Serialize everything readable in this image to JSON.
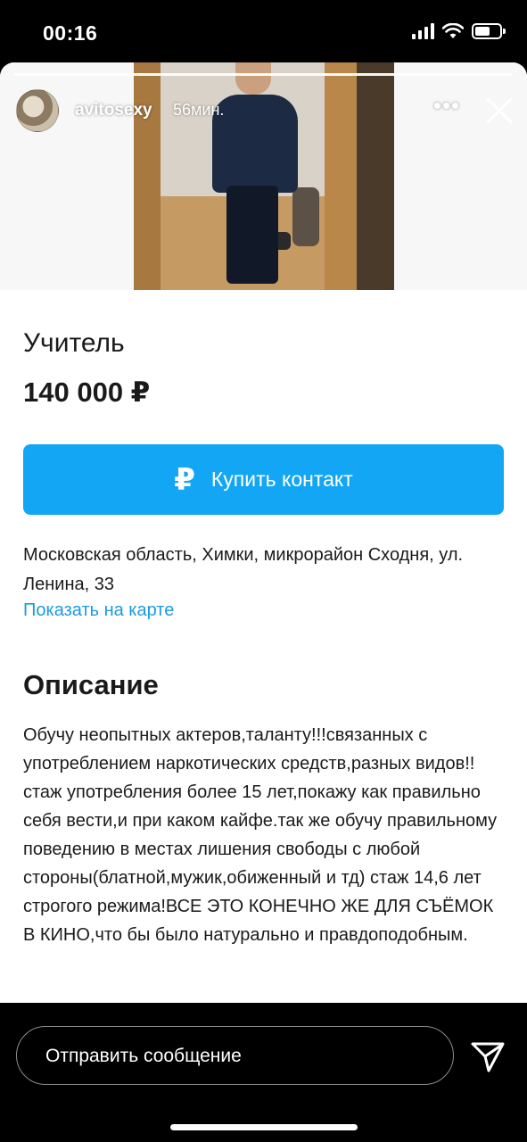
{
  "status_bar": {
    "time": "00:16",
    "icons": [
      "cellular-signal-icon",
      "wifi-icon",
      "battery-icon"
    ],
    "battery_level": 0.6
  },
  "story": {
    "username": "avitosexy",
    "time_ago": "56мин.",
    "more_icon": "more-horizontal-icon",
    "more_glyph": "•••",
    "close_icon": "close-icon"
  },
  "listing": {
    "title": "Учитель",
    "price": "140 000 ₽",
    "buy_icon": "ruble-icon",
    "buy_glyph": "₽",
    "buy_button": "Купить контакт",
    "address": "Московская область, Химки, микрорайон Сходня, ул. Ленина, 33",
    "map_link": "Показать на карте",
    "description_title": "Описание",
    "description": "Обучу неопытных актеров,таланту!!!связанных с употреблением наркотических средств,разных видов!!стаж употребления более 15 лет,покажу как правильно себя вести,и при каком кайфе.так же обучу правильному поведению в местах лишения свободы с любой стороны(блатной,мужик,обиженный и тд) стаж 14,6 лет строгого режима!ВСЕ ЭТО КОНЕЧНО ЖЕ ДЛЯ СЪЁМОК В КИНО,что бы было натурально и правдоподобным."
  },
  "reply": {
    "placeholder": "Отправить сообщение",
    "send_icon": "send-icon"
  },
  "colors": {
    "accent": "#13a6f5",
    "link": "#1a9be0",
    "background": "#000000",
    "card": "#ffffff"
  }
}
